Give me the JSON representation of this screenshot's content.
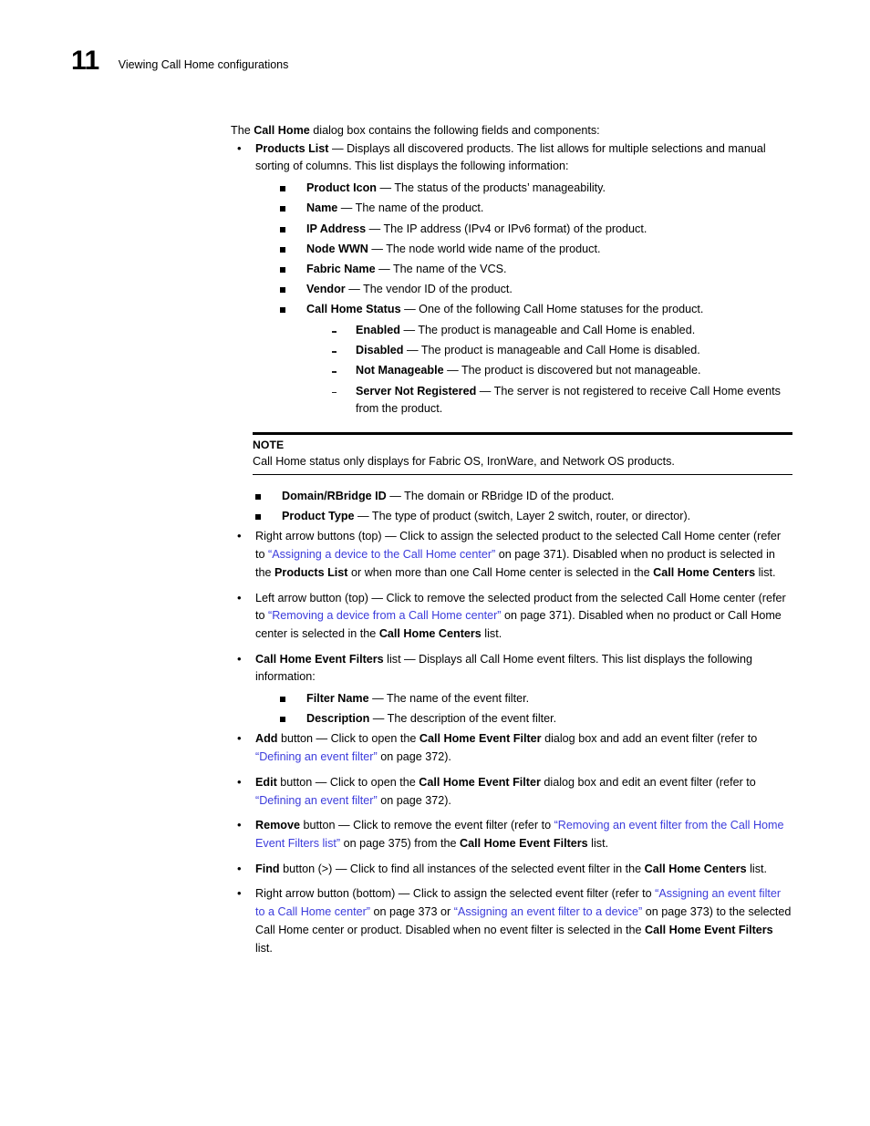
{
  "header": {
    "chapter_number": "11",
    "chapter_title": "Viewing Call Home configurations"
  },
  "intro": {
    "before": "The ",
    "bold": "Call Home",
    "after": " dialog box contains the following fields and components:"
  },
  "products_list": {
    "term": "Products List",
    "desc": " — Displays all discovered products. The list allows for multiple selections and manual sorting of columns. This list displays the following information:",
    "items": [
      {
        "term": "Product Icon",
        "desc": " — The status of the products’ manageability."
      },
      {
        "term": "Name",
        "desc": " — The name of the product."
      },
      {
        "term": "IP Address",
        "desc": " — The IP address (IPv4 or IPv6 format) of the product."
      },
      {
        "term": "Node WWN",
        "desc": " — The node world wide name of the product."
      },
      {
        "term": "Fabric Name",
        "desc": " — The name of the VCS."
      },
      {
        "term": "Vendor",
        "desc": " — The vendor ID of the product."
      },
      {
        "term": "Call Home Status",
        "desc": " — One of the following Call Home statuses for the product."
      }
    ],
    "statuses": [
      {
        "term": "Enabled",
        "desc": " — The product is manageable and Call Home is enabled."
      },
      {
        "term": "Disabled",
        "desc": " — The product is manageable and Call Home is disabled."
      },
      {
        "term": "Not Manageable",
        "desc": " — The product is discovered but not manageable."
      },
      {
        "term": "Server Not Registered",
        "desc": " — The server is not registered to receive Call Home events from the product."
      }
    ]
  },
  "note": {
    "label": "NOTE",
    "text": "Call Home status only displays for Fabric OS, IronWare, and Network OS products."
  },
  "after_note_items": [
    {
      "term": "Domain/RBridge ID",
      "desc": "  — The domain or RBridge ID of the product."
    },
    {
      "term": "Product Type",
      "desc": " — The type of product (switch, Layer 2 switch, router, or director)."
    }
  ],
  "right_arrow_top": {
    "s1": "Right arrow buttons (top) — Click to assign the selected product to the selected Call Home center (refer to ",
    "link": "“Assigning a device to the Call Home center”",
    "s2": " on page 371). Disabled when no product is selected in the ",
    "b1": "Products List",
    "s3": " or when more than one Call Home center is selected in the ",
    "b2": "Call Home Centers",
    "s4": " list."
  },
  "left_arrow_top": {
    "s1": "Left arrow button (top) — Click to remove the selected product from the selected Call Home center (refer to ",
    "link": "“Removing a device from a Call Home center”",
    "s2": " on page 371). Disabled when no product or Call Home center is selected in the ",
    "b1": "Call Home Centers",
    "s3": " list."
  },
  "event_filters_list": {
    "term": "Call Home Event Filters",
    "desc": " list — Displays all Call Home event filters. This list displays the following information:",
    "items": [
      {
        "term": "Filter Name",
        "desc": " — The name of the event filter."
      },
      {
        "term": "Description",
        "desc": " — The description of the event filter."
      }
    ]
  },
  "add_button": {
    "b0": "Add",
    "s1": " button — Click to open the ",
    "b1": "Call Home Event Filter",
    "s2": " dialog box and add an event filter (refer to ",
    "link": "“Defining an event filter”",
    "s3": " on page 372)."
  },
  "edit_button": {
    "b0": "Edit",
    "s1": " button — Click to open the ",
    "b1": "Call Home Event Filter",
    "s2": " dialog box and edit an event filter (refer to ",
    "link": "“Defining an event filter”",
    "s3": " on page 372)."
  },
  "remove_button": {
    "b0": "Remove",
    "s1": " button — Click to remove the event filter (refer to ",
    "link": "“Removing an event filter from the Call Home Event Filters list”",
    "s2": " on page 375) from the ",
    "b1": "Call Home Event Filters",
    "s3": " list."
  },
  "find_button": {
    "b0": "Find",
    "s1": " button (>) — Click to find all instances of the selected event filter in the ",
    "b1": "Call Home Centers",
    "s2": " list."
  },
  "right_arrow_bottom": {
    "s1": "Right arrow button (bottom) — Click to assign the selected event filter (refer to ",
    "link1": "“Assigning an event filter to a Call Home center”",
    "s2": " on page 373 or ",
    "link2": "“Assigning an event filter to a device”",
    "s3": " on page 373) to the selected Call Home center or product. Disabled when no event filter is selected in the ",
    "b1": "Call Home Event Filters",
    "s4": " list."
  },
  "colors": {
    "link": "#3c3cdc",
    "text": "#000000"
  }
}
